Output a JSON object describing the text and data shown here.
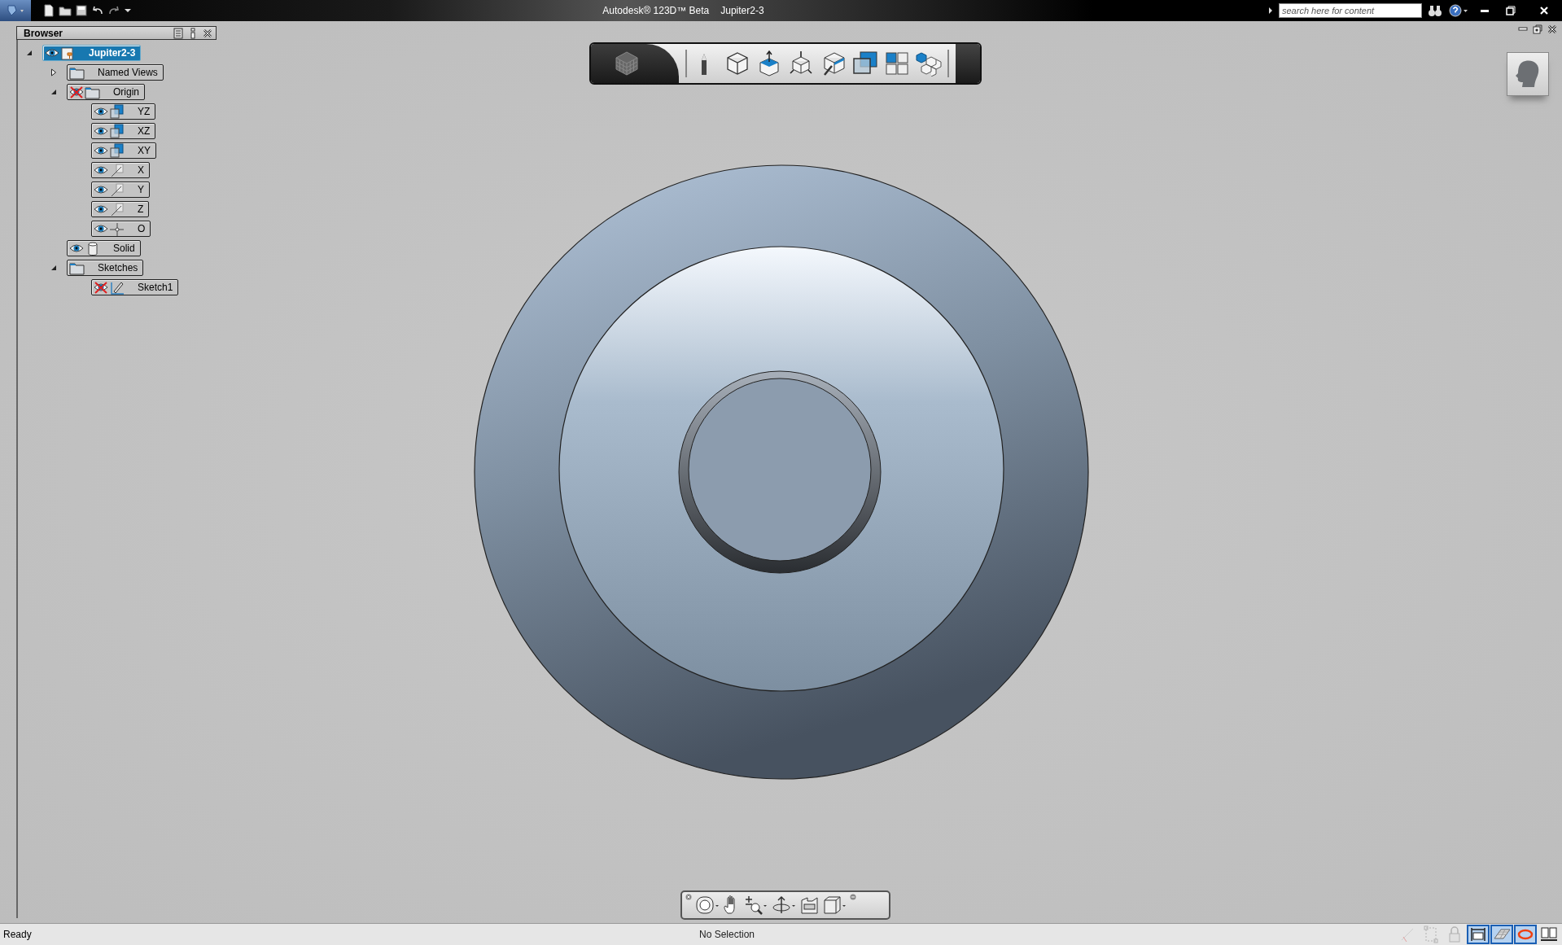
{
  "title_bar": {
    "app": "Autodesk® 123D™ Beta",
    "document": "Jupiter2-3",
    "search": {
      "placeholder": "search here for content"
    }
  },
  "browser": {
    "title": "Browser",
    "tree": [
      {
        "label": "Jupiter2-3",
        "kind": "part",
        "selected": true,
        "visible": true,
        "expanded": true,
        "children": [
          {
            "label": "Named Views",
            "kind": "folder",
            "selected": false,
            "expanded": false
          },
          {
            "label": "Origin",
            "kind": "folder",
            "selected": false,
            "visible": false,
            "expanded": true,
            "children": [
              {
                "label": "YZ",
                "kind": "plane",
                "selected": false,
                "visible": true
              },
              {
                "label": "XZ",
                "kind": "plane",
                "selected": false,
                "visible": true
              },
              {
                "label": "XY",
                "kind": "plane",
                "selected": false,
                "visible": true
              },
              {
                "label": "X",
                "kind": "axis",
                "selected": false,
                "visible": true
              },
              {
                "label": "Y",
                "kind": "axis",
                "selected": false,
                "visible": true
              },
              {
                "label": "Z",
                "kind": "axis",
                "selected": false,
                "visible": true
              },
              {
                "label": "O",
                "kind": "point",
                "selected": false,
                "visible": true
              }
            ]
          },
          {
            "label": "Solid",
            "kind": "body",
            "selected": false,
            "visible": true
          },
          {
            "label": "Sketches",
            "kind": "folder",
            "selected": false,
            "expanded": true,
            "children": [
              {
                "label": "Sketch1",
                "kind": "sketch",
                "selected": false,
                "visible": false
              }
            ]
          }
        ]
      }
    ]
  },
  "status_bar": {
    "message": "Ready",
    "selection": "No Selection",
    "toggles": [
      {
        "selected": false,
        "disabled": true
      },
      {
        "selected": false,
        "disabled": true
      },
      {
        "selected": false,
        "disabled": true
      },
      {
        "selected": true,
        "disabled": false
      },
      {
        "selected": true,
        "disabled": false
      },
      {
        "selected": true,
        "disabled": false
      },
      {
        "selected": false,
        "disabled": false
      }
    ]
  }
}
